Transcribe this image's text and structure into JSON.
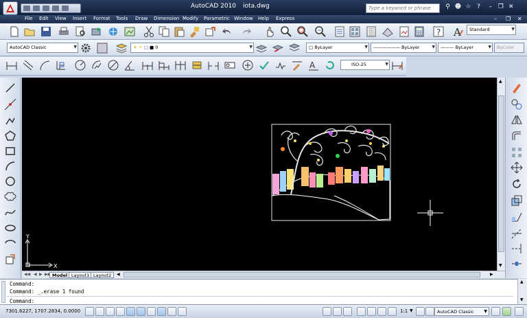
{
  "title_bar": {
    "app_name": "AutoCAD 2010",
    "file_name": "iota.dwg",
    "search_placeholder": "Type a keyword or phrase"
  },
  "menu": [
    "File",
    "Edit",
    "View",
    "Insert",
    "Format",
    "Tools",
    "Draw",
    "Dimension",
    "Modify",
    "Parametric",
    "Window",
    "Help",
    "Express"
  ],
  "toolbars": {
    "workspace": "AutoCAD Classic",
    "layer": "0",
    "text_style": "Standard",
    "dim_style": "ISO-25",
    "color": "ByLayer",
    "linetype": "ByLayer",
    "lineweight": "ByLayer",
    "plot_style": "ByColor"
  },
  "canvas": {
    "ucs_x_label": "X",
    "ucs_y_label": "Y"
  },
  "layout_tabs": [
    "Model",
    "Layout1",
    "Layout2"
  ],
  "command_window": {
    "line1": "Command:",
    "line2": "Command:  _.erase 1 found",
    "prompt": "Command:"
  },
  "status_bar": {
    "coordinates": "7301.6227, 1707.2834, 0.0000",
    "scale": "1:1",
    "workspace": "AutoCAD Classic"
  },
  "colors": {
    "titlebar": "#1b2b4a",
    "canvas": "#000000",
    "toolbar": "#dfe7f2"
  }
}
